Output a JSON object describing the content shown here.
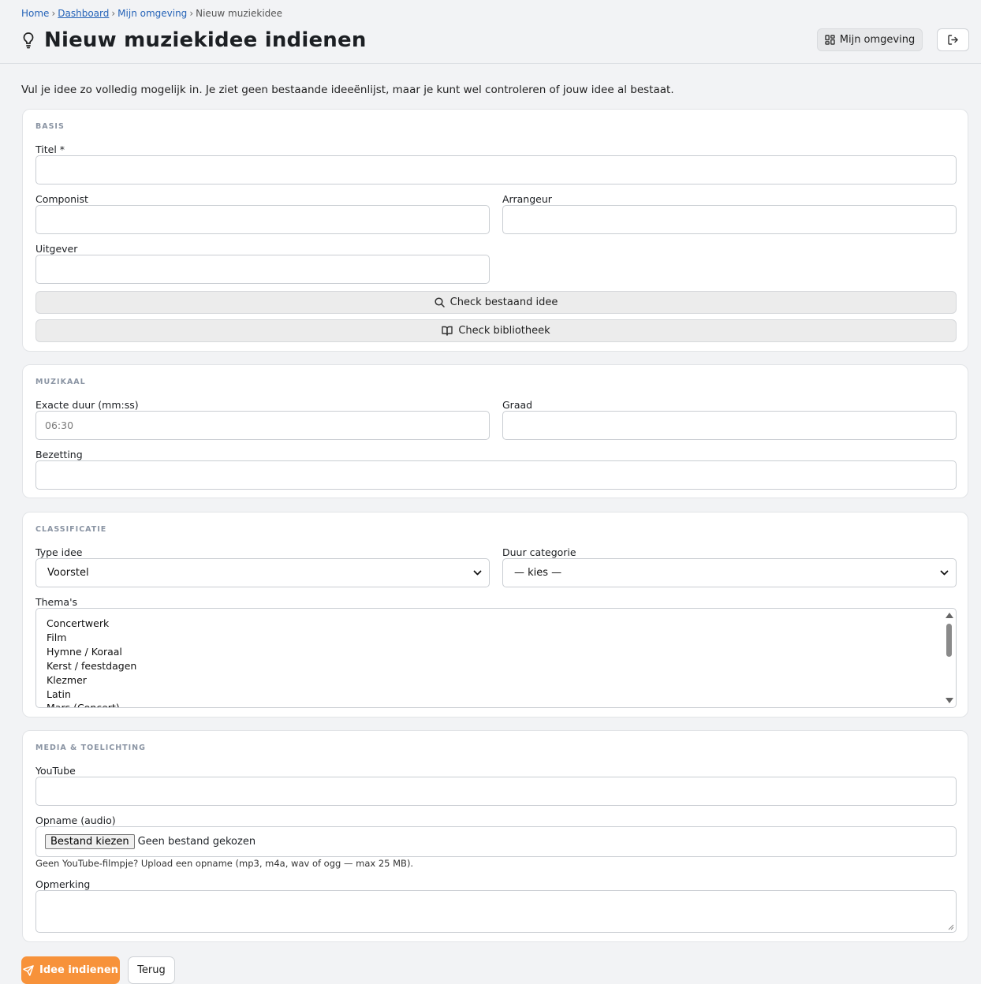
{
  "breadcrumb": {
    "home": "Home",
    "dashboard": "Dashboard",
    "environment": "Mijn omgeving",
    "current": "Nieuw muziekidee",
    "separator": "›"
  },
  "header": {
    "title": "Nieuw muziekidee indienen",
    "env_button": "Mijn omgeving",
    "title_icon": "lightbulb-icon",
    "logout_icon": "logout-icon"
  },
  "intro": "Vul je idee zo volledig mogelijk in. Je ziet geen bestaande ideeënlijst, maar je kunt wel controleren of jouw idee al bestaat.",
  "basis": {
    "section": "BASIS",
    "titel_label": "Titel *",
    "componist_label": "Componist",
    "arrangeur_label": "Arrangeur",
    "uitgever_label": "Uitgever",
    "check_idea_button": "Check bestaand idee",
    "check_library_button": "Check bibliotheek"
  },
  "muzikaal": {
    "section": "MUZIKAAL",
    "duur_label": "Exacte duur (mm:ss)",
    "duur_placeholder": "06:30",
    "graad_label": "Graad",
    "bezetting_label": "Bezetting"
  },
  "classificatie": {
    "section": "CLASSIFICATIE",
    "type_label": "Type idee",
    "type_value": "Voorstel",
    "duur_cat_label": "Duur categorie",
    "duur_cat_value": "— kies —",
    "themas_label": "Thema's",
    "themas": [
      "Concertwerk",
      "Film",
      "Hymne / Koraal",
      "Kerst / feestdagen",
      "Klezmer",
      "Latin",
      "Mars (Concert)"
    ]
  },
  "media": {
    "section": "MEDIA & TOELICHTING",
    "youtube_label": "YouTube",
    "opname_label": "Opname (audio)",
    "file_button": "Bestand kiezen",
    "file_status": "Geen bestand gekozen",
    "hint": "Geen YouTube-filmpje? Upload een opname (mp3, m4a, wav of ogg — max 25 MB).",
    "opmerking_label": "Opmerking"
  },
  "actions": {
    "submit": "Idee indienen",
    "back": "Terug"
  },
  "colors": {
    "accent": "#f7923a",
    "link": "#2563b8",
    "background": "#f2f3f5"
  }
}
